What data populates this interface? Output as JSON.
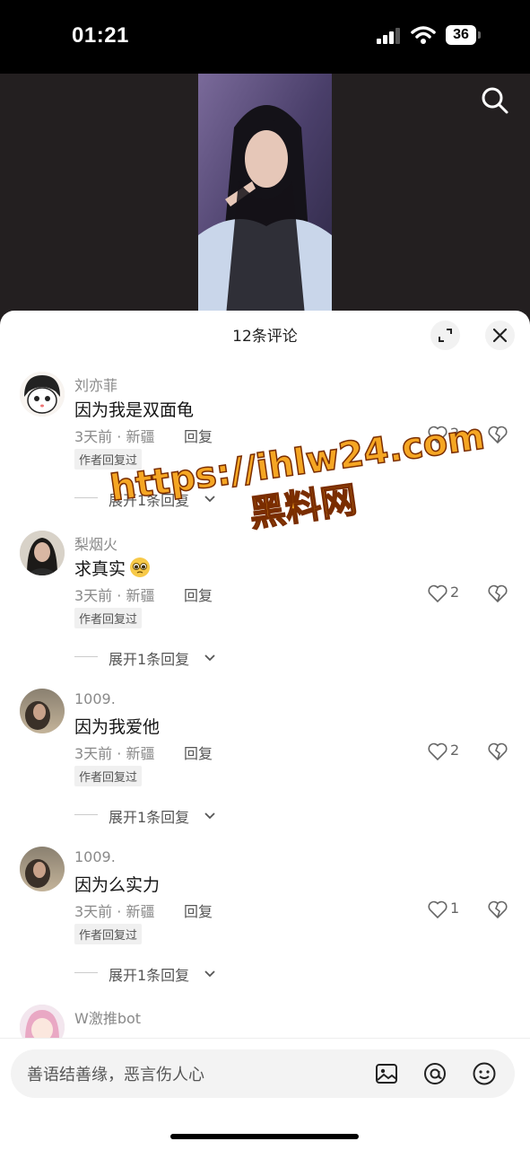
{
  "status_bar": {
    "time": "01:21",
    "battery": "36"
  },
  "sheet": {
    "title": "12条评论"
  },
  "comments": [
    {
      "username": "刘亦菲",
      "text": "因为我是双面龟",
      "meta": "3天前 · 新疆",
      "reply": "回复",
      "badge": "作者回复过",
      "likes": "2",
      "expand": "展开1条回复"
    },
    {
      "username": "梨烟火",
      "text": "求真实",
      "meta": "3天前 · 新疆",
      "reply": "回复",
      "badge": "作者回复过",
      "likes": "2",
      "expand": "展开1条回复"
    },
    {
      "username": "1009.",
      "text": "因为我爱他",
      "meta": "3天前 · 新疆",
      "reply": "回复",
      "badge": "作者回复过",
      "likes": "2",
      "expand": "展开1条回复"
    },
    {
      "username": "1009.",
      "text": "因为么实力",
      "meta": "3天前 · 新疆",
      "reply": "回复",
      "badge": "作者回复过",
      "likes": "1",
      "expand": "展开1条回复"
    },
    {
      "username": "W激推bot",
      "text": "",
      "meta": "",
      "reply": "",
      "badge": "",
      "likes": "",
      "expand": ""
    }
  ],
  "watermark": {
    "url": "https://ihlw24.com",
    "name": "黑料网"
  },
  "input": {
    "placeholder": "善语结善缘，恶言伤人心"
  },
  "icons": [
    "search-icon",
    "expand-icon",
    "close-icon",
    "heart-icon",
    "dislike-icon",
    "chevron-down-icon",
    "image-icon",
    "at-icon",
    "emoji-icon"
  ],
  "colors": {
    "watermark": "#f5a623",
    "sheet_bg": "#ffffff",
    "video_bg": "#231f20"
  }
}
